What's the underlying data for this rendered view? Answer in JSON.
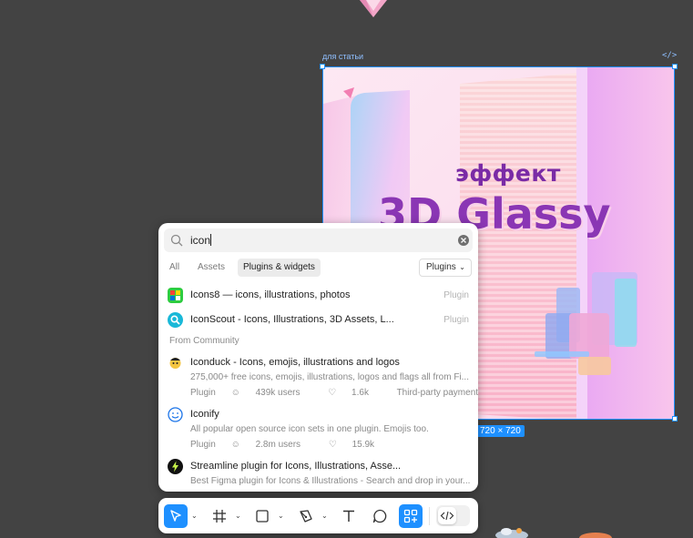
{
  "canvas": {
    "background": "#434343",
    "selection_color": "#1e90ff",
    "frame": {
      "label": "для статьи",
      "code_icon": "code-icon",
      "size_badge": "720 × 720",
      "artwork": {
        "line1": "эффект",
        "line2": "3D Glassy"
      }
    }
  },
  "search_panel": {
    "query": "icon",
    "placeholder": "",
    "tabs": [
      {
        "label": "All",
        "active": false
      },
      {
        "label": "Assets",
        "active": false
      },
      {
        "label": "Plugins & widgets",
        "active": true
      }
    ],
    "filter_dropdown": "Plugins",
    "results": [
      {
        "title": "Icons8 — icons, illustrations, photos",
        "tag": "Plugin",
        "icon": "icons8-icon"
      },
      {
        "title": "IconScout - Icons, Illustrations, 3D Assets, L...",
        "tag": "Plugin",
        "icon": "iconscout-icon"
      }
    ],
    "community_label": "From Community",
    "community": [
      {
        "title": "Iconduck - Icons, emojis, illustrations and logos",
        "desc": "275,000+ free icons, emojis, illustrations, logos and flags all from Fi...",
        "type": "Plugin",
        "users": "439k users",
        "likes": "1.6k",
        "extra": "Third-party payment",
        "icon": "iconduck-icon"
      },
      {
        "title": "Iconify",
        "desc": "All popular open source icon sets in one plugin. Emojis too.",
        "type": "Plugin",
        "users": "2.8m users",
        "likes": "15.9k",
        "extra": "",
        "icon": "iconify-icon"
      },
      {
        "title": "Streamline plugin for Icons, Illustrations, Asse...",
        "desc": "Best Figma plugin for Icons & Illustrations - Search and drop in your...",
        "icon": "streamline-icon"
      }
    ]
  },
  "toolbar": {
    "tools": [
      {
        "name": "move-tool",
        "icon": "cursor-icon",
        "active": true
      },
      {
        "name": "frame-tool",
        "icon": "frame-hash-icon",
        "active": false
      },
      {
        "name": "shape-tool",
        "icon": "rectangle-icon",
        "active": false
      },
      {
        "name": "pen-tool",
        "icon": "pen-icon",
        "active": false
      },
      {
        "name": "text-tool",
        "icon": "text-icon",
        "active": false
      },
      {
        "name": "comment-tool",
        "icon": "comment-icon",
        "active": false
      },
      {
        "name": "actions-tool",
        "icon": "actions-grid-icon",
        "active": true
      }
    ],
    "dev_mode_icon": "code-icon"
  }
}
